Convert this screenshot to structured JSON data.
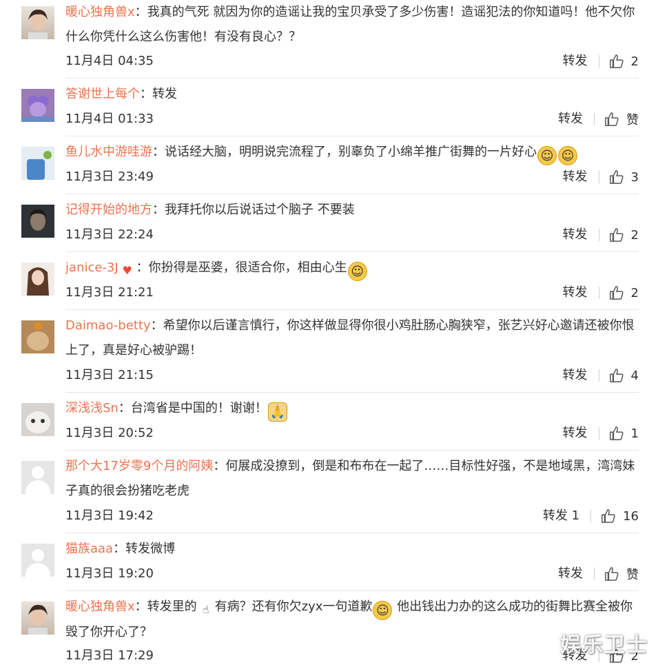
{
  "comments": [
    {
      "user": "暖心独角兽x",
      "text": "我真的气死 就因为你的造谣让我的宝贝承受了多少伤害！造谣犯法的你知道吗！他不欠你什么你凭什么这么伤害他！有没有良心？？",
      "time": "11月4日 04:35",
      "forward": "转发",
      "likes": "2"
    },
    {
      "user": "答谢世上每个",
      "text": "转发",
      "time": "11月4日 01:33",
      "forward": "转发",
      "likes": "赞"
    },
    {
      "user": "鱼儿水中游哇游",
      "text": "说话经大脑，明明说完流程了，别辜负了小绵羊推广街舞的一片好心",
      "time": "11月3日 23:49",
      "forward": "转发",
      "likes": "3"
    },
    {
      "user": "记得开始的地方",
      "text": "我拜托你以后说话过个脑子 不要装",
      "time": "11月3日 22:24",
      "forward": "转发",
      "likes": "2"
    },
    {
      "user": "janice-3J",
      "text": "你扮得是巫婆，很适合你，相由心生",
      "time": "11月3日 21:21",
      "forward": "转发",
      "likes": "2"
    },
    {
      "user": "Daimao-betty",
      "text": "希望你以后谨言慎行，你这样做显得你很小鸡肚肠心胸狭窄，张艺兴好心邀请还被你恨上了，真是好心被驴踢！",
      "time": "11月3日 21:15",
      "forward": "转发",
      "likes": "4"
    },
    {
      "user": "深浅浅Sn",
      "text": "台湾省是中国的！谢谢！",
      "time": "11月3日 20:52",
      "forward": "转发",
      "likes": "1"
    },
    {
      "user": "那个大17岁零9个月的阿姨",
      "text": "何展成没撩到，倒是和布布在一起了……目标性好强，不是地域黑，湾湾妹子真的很会扮猪吃老虎",
      "time": "11月3日 19:42",
      "forward": "转发 1",
      "likes": "16"
    },
    {
      "user": "猫族aaa",
      "text": "转发微博",
      "time": "11月3日 19:20",
      "forward": "转发",
      "likes": "赞"
    },
    {
      "user": "暖心独角兽x",
      "text_a": "转发里的",
      "text_b": "有病？还有你欠zyx一句道歉",
      "text_c": " 他出钱出力办的这么成功的街舞比赛全被你毁了你开心了？",
      "time": "11月3日 17:29",
      "forward": "转发",
      "likes": "2"
    }
  ],
  "colon": "：",
  "watermark": "娱乐卫士",
  "icons": {
    "thumb": "thumbs-up-icon",
    "smile": "smile-emoji",
    "grin": "grin-emoji",
    "pray": "pray-emoji",
    "finger": "pointing-hand-emoji",
    "badge": "heart-hands-icon"
  },
  "colors": {
    "username": "#eb7350",
    "text": "#333333",
    "divider": "#e6e6e6"
  }
}
